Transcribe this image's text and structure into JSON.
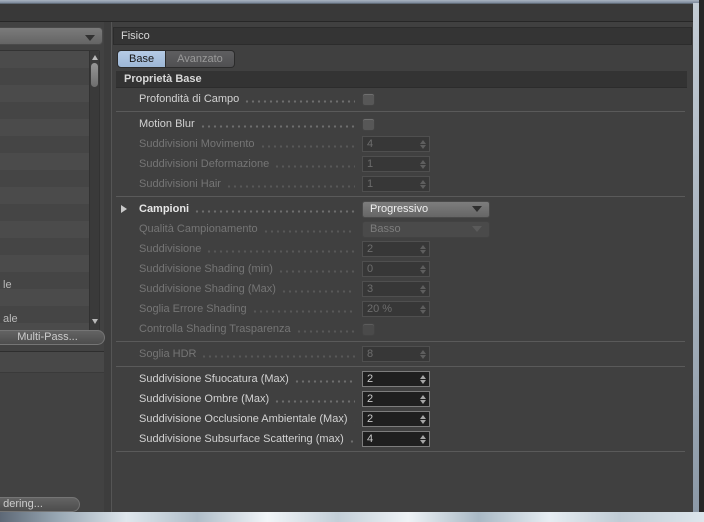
{
  "colors": {
    "panel_bg": "#404040",
    "header_bg": "#343434",
    "tab_active_blue": "#a9c1de",
    "input_bg": "#1f1f1f",
    "frame_accent": "#9aa7b5",
    "disabled_text": "#757575",
    "enabled_text": "#d2d2d2"
  },
  "sidebar": {
    "preset_dropdown": {
      "value": ""
    },
    "list_items": [
      {
        "label": "le"
      },
      {
        "label": "ale"
      }
    ],
    "multipass_button": "Multi-Pass...",
    "render_button": "dering..."
  },
  "panel": {
    "title": "Fisico",
    "tabs": [
      {
        "label": "Base",
        "active": true
      },
      {
        "label": "Avanzato",
        "active": false
      }
    ],
    "section_header": "Proprietà Base",
    "groups": [
      {
        "rows": [
          {
            "label": "Profondità di Campo",
            "control": "checkbox",
            "checked": false,
            "enabled": true
          }
        ]
      },
      {
        "rows": [
          {
            "label": "Motion Blur",
            "control": "checkbox",
            "checked": false,
            "enabled": true
          },
          {
            "label": "Suddivisioni Movimento",
            "control": "stepper",
            "value": "4",
            "enabled": false
          },
          {
            "label": "Suddivisioni Deformazione",
            "control": "stepper",
            "value": "1",
            "enabled": false
          },
          {
            "label": "Suddivisioni Hair",
            "control": "stepper",
            "value": "1",
            "enabled": false
          }
        ]
      },
      {
        "rows": [
          {
            "label": "Campioni",
            "control": "dropdown",
            "value": "Progressivo",
            "enabled": true,
            "bold": true,
            "expander": true
          },
          {
            "label": "Qualità Campionamento",
            "control": "dropdown",
            "value": "Basso",
            "enabled": false
          },
          {
            "label": "Suddivisione",
            "control": "stepper",
            "value": "2",
            "enabled": false
          },
          {
            "label": "Suddivisione Shading (min)",
            "control": "stepper",
            "value": "0",
            "enabled": false
          },
          {
            "label": "Suddivisione Shading (Max)",
            "control": "stepper",
            "value": "3",
            "enabled": false
          },
          {
            "label": "Soglia Errore Shading",
            "control": "stepper",
            "value": "20 %",
            "enabled": false
          },
          {
            "label": "Controlla Shading Trasparenza",
            "control": "checkbox",
            "checked": false,
            "enabled": false
          }
        ]
      },
      {
        "rows": [
          {
            "label": "Soglia HDR",
            "control": "stepper",
            "value": "8",
            "enabled": false
          }
        ]
      },
      {
        "rows": [
          {
            "label": "Suddivisione Sfuocatura (Max)",
            "control": "stepper",
            "value": "2",
            "enabled": true
          },
          {
            "label": "Suddivisione Ombre (Max)",
            "control": "stepper",
            "value": "2",
            "enabled": true
          },
          {
            "label": "Suddivisione Occlusione Ambientale (Max)",
            "control": "stepper",
            "value": "2",
            "enabled": true
          },
          {
            "label": "Suddivisione Subsurface Scattering (max)",
            "control": "stepper",
            "value": "4",
            "enabled": true
          }
        ]
      }
    ]
  }
}
